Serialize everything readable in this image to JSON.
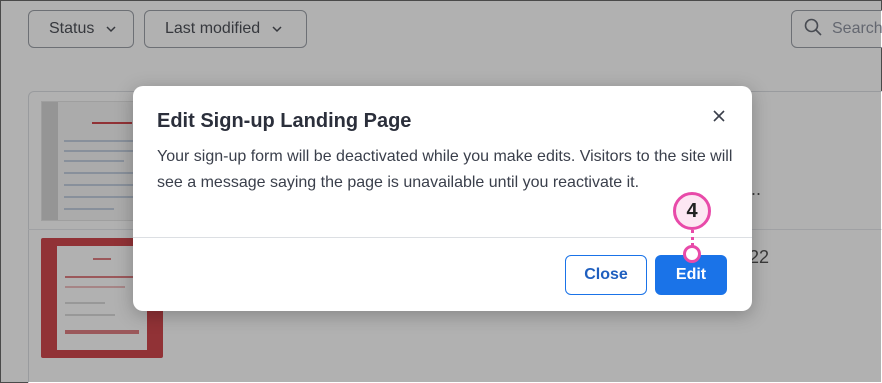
{
  "filters": {
    "status_label": "Status",
    "modified_label": "Last modified"
  },
  "search": {
    "placeholder": "Search"
  },
  "background": {
    "truncated_text": "...",
    "partial_number": "22"
  },
  "modal": {
    "title": "Edit Sign-up Landing Page",
    "body": "Your sign-up form will be deactivated while you make edits. Visitors to the site will see a message saying the page is unavailable until you reactivate it.",
    "close_button": "Close",
    "edit_button": "Edit"
  },
  "callout": {
    "step": "4"
  },
  "colors": {
    "primary": "#1a73e8",
    "callout": "#e84aa9",
    "thumbnail_red": "#c9252c"
  }
}
